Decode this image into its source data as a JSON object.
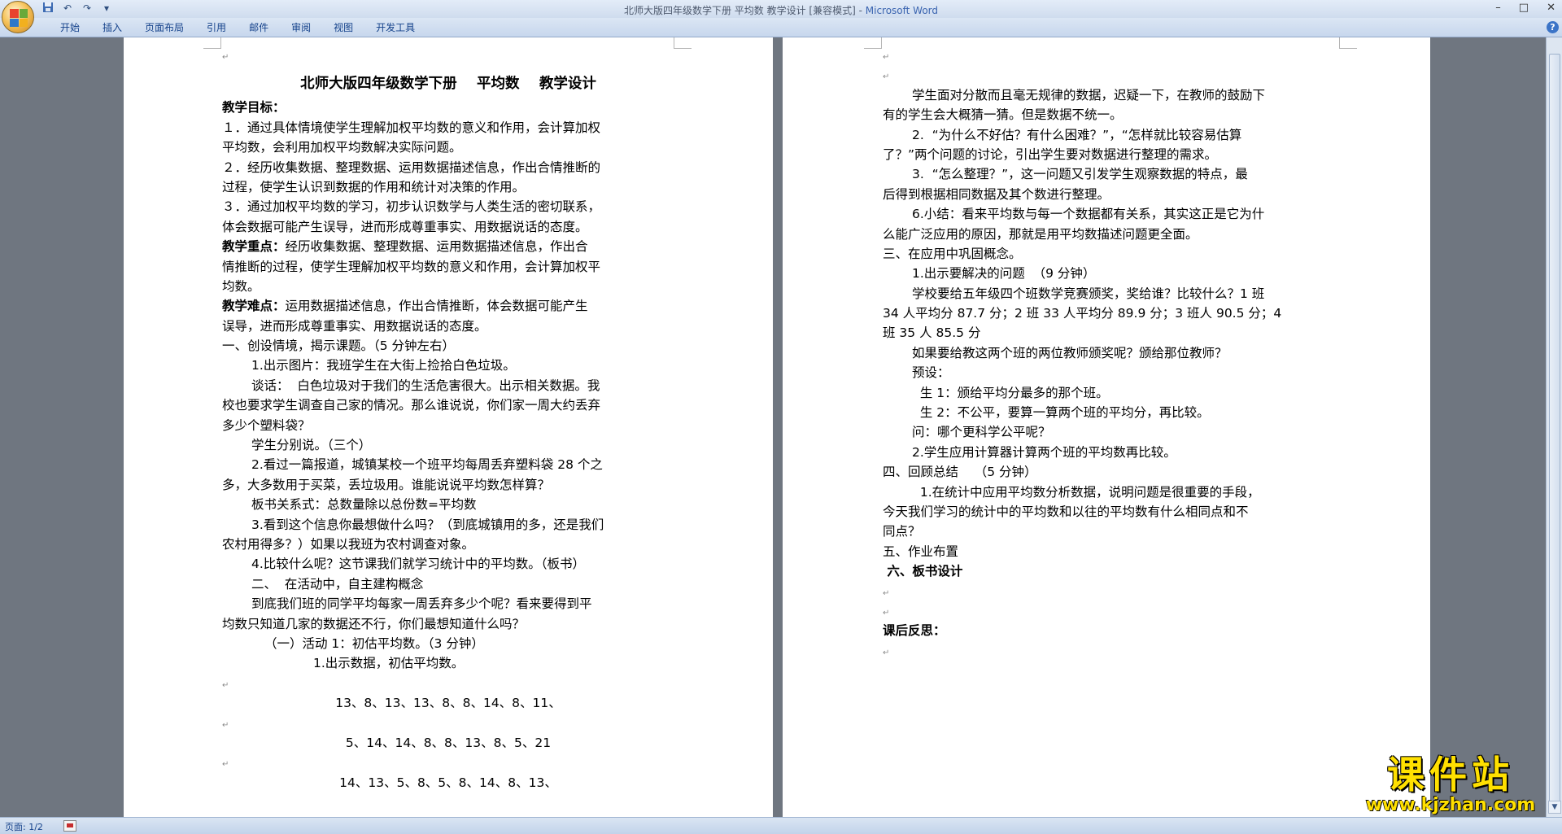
{
  "window": {
    "title": "北师大版四年级数学下册  平均数  教学设计 [兼容模式] - ",
    "app_name": "Microsoft Word",
    "minimize": "–",
    "maximize": "□",
    "close": "✕"
  },
  "qat": {
    "save_icon": "save-icon",
    "undo": "↶",
    "redo": "↷",
    "dropdown": "▾"
  },
  "ribbon": {
    "tabs": [
      "开始",
      "插入",
      "页面布局",
      "引用",
      "邮件",
      "审阅",
      "视图",
      "开发工具"
    ],
    "help": "?"
  },
  "page1": {
    "lines": [
      {
        "t": "",
        "s": "mark"
      },
      {
        "t": "北师大版四年级数学下册    平均数    教学设计",
        "s": "title"
      },
      {
        "t": "教学目标：",
        "s": "b"
      },
      {
        "t": "１．通过具体情境使学生理解加权平均数的意义和作用，会计算加权",
        "s": ""
      },
      {
        "t": "平均数，会利用加权平均数解决实际问题。",
        "s": ""
      },
      {
        "t": "２．经历收集数据、整理数据、运用数据描述信息，作出合情推断的",
        "s": ""
      },
      {
        "t": "过程，使学生认识到数据的作用和统计对决策的作用。",
        "s": ""
      },
      {
        "t": "３．通过加权平均数的学习，初步认识数学与人类生活的密切联系，",
        "s": ""
      },
      {
        "t": "体会数据可能产生误导，进而形成尊重事实、用数据说话的态度。",
        "s": ""
      },
      {
        "t": "教学重点：经历收集数据、整理数据、运用数据描述信息，作出合",
        "s": "bh"
      },
      {
        "t": "情推断的过程，使学生理解加权平均数的意义和作用，会计算加权平",
        "s": ""
      },
      {
        "t": "均数。",
        "s": ""
      },
      {
        "t": "教学难点：运用数据描述信息，作出合情推断，体会数据可能产生",
        "s": "bh"
      },
      {
        "t": "误导，进而形成尊重事实、用数据说话的态度。",
        "s": ""
      },
      {
        "t": "一、创设情境，揭示课题。（5 分钟左右）",
        "s": ""
      },
      {
        "t": "1.出示图片：我班学生在大街上捡拾白色垃圾。",
        "s": "i1"
      },
      {
        "t": "谈话：  白色垃圾对于我们的生活危害很大。出示相关数据。我",
        "s": "i1"
      },
      {
        "t": "校也要求学生调查自己家的情况。那么谁说说，你们家一周大约丢弃",
        "s": ""
      },
      {
        "t": "多少个塑料袋？",
        "s": ""
      },
      {
        "t": "学生分别说。（三个）",
        "s": "i1"
      },
      {
        "t": "2.看过一篇报道，城镇某校一个班平均每周丢弃塑料袋 28 个之",
        "s": "i1"
      },
      {
        "t": "多，大多数用于买菜，丢垃圾用。谁能说说平均数怎样算？",
        "s": ""
      },
      {
        "t": "板书关系式：总数量除以总份数=平均数",
        "s": "i1"
      },
      {
        "t": "3.看到这个信息你最想做什么吗？（到底城镇用的多，还是我们",
        "s": "i1"
      },
      {
        "t": "农村用得多？）如果以我班为农村调查对象。",
        "s": ""
      },
      {
        "t": "4.比较什么呢？这节课我们就学习统计中的平均数。（板书）",
        "s": "i1"
      },
      {
        "t": "二、  在活动中，自主建构概念",
        "s": "i1"
      },
      {
        "t": "到底我们班的同学平均每家一周丢弃多少个呢？看来要得到平",
        "s": "i1"
      },
      {
        "t": "均数只知道几家的数据还不行，你们最想知道什么吗？",
        "s": ""
      },
      {
        "t": "（一）活动 1：初估平均数。（3 分钟）",
        "s": "i2"
      },
      {
        "t": "1.出示数据，初估平均数。",
        "s": "i3"
      },
      {
        "t": "",
        "s": "mark"
      },
      {
        "t": "13、8、13、13、8、8、14、8、11、",
        "s": "c"
      },
      {
        "t": "",
        "s": "mark"
      },
      {
        "t": "5、14、14、8、8、13、8、5、21",
        "s": "c"
      },
      {
        "t": "",
        "s": "mark"
      },
      {
        "t": "14、13、5、8、5、8、14、8、13、",
        "s": "c"
      }
    ]
  },
  "page2": {
    "lines": [
      {
        "t": "",
        "s": "mark"
      },
      {
        "t": "",
        "s": "mark"
      },
      {
        "t": "学生面对分散而且毫无规律的数据，迟疑一下，在教师的鼓励下",
        "s": "i1"
      },
      {
        "t": "有的学生会大概猜一猜。但是数据不统一。",
        "s": ""
      },
      {
        "t": "2.  “为什么不好估？有什么困难？”，“怎样就比较容易估算",
        "s": "i1"
      },
      {
        "t": "了？”两个问题的讨论，引出学生要对数据进行整理的需求。",
        "s": ""
      },
      {
        "t": "3.  “怎么整理？”，这一问题又引发学生观察数据的特点，最",
        "s": "i1"
      },
      {
        "t": "后得到根据相同数据及其个数进行整理。",
        "s": ""
      },
      {
        "t": "6.小结：看来平均数与每一个数据都有关系，其实这正是它为什",
        "s": "i1"
      },
      {
        "t": "么能广泛应用的原因，那就是用平均数描述问题更全面。",
        "s": ""
      },
      {
        "t": "三、在应用中巩固概念。",
        "s": ""
      },
      {
        "t": "1.出示要解决的问题  （9 分钟）",
        "s": "i1"
      },
      {
        "t": "学校要给五年级四个班数学竞赛颁奖，奖给谁？比较什么？1 班",
        "s": "i1"
      },
      {
        "t": "34 人平均分 87.7 分；2 班 33 人平均分 89.9 分；3 班人 90.5 分；4",
        "s": ""
      },
      {
        "t": "班 35 人 85.5 分",
        "s": ""
      },
      {
        "t": "如果要给教这两个班的两位教师颁奖呢？颁给那位教师？",
        "s": "i1"
      },
      {
        "t": "预设：",
        "s": "i1"
      },
      {
        "t": "  生 1：颁给平均分最多的那个班。",
        "s": "i1"
      },
      {
        "t": "  生 2：不公平，要算一算两个班的平均分，再比较。",
        "s": "i1"
      },
      {
        "t": "问：哪个更科学公平呢？",
        "s": "i1"
      },
      {
        "t": "2.学生应用计算器计算两个班的平均数再比较。",
        "s": "i1"
      },
      {
        "t": "四、回顾总结    （5 分钟）",
        "s": ""
      },
      {
        "t": "  1.在统计中应用平均数分析数据，说明问题是很重要的手段，",
        "s": "i1"
      },
      {
        "t": "今天我们学习的统计中的平均数和以往的平均数有什么相同点和不",
        "s": ""
      },
      {
        "t": "同点？",
        "s": ""
      },
      {
        "t": "五、作业布置",
        "s": ""
      },
      {
        "t": " 六、板书设计",
        "s": "b"
      },
      {
        "t": "",
        "s": "mark"
      },
      {
        "t": "",
        "s": "mark"
      },
      {
        "t": "课后反思：",
        "s": "b"
      },
      {
        "t": "",
        "s": "mark"
      }
    ]
  },
  "status": {
    "page": "页面: 1/2"
  },
  "watermark": {
    "big": "课件站",
    "small": "www.kjzhan.com"
  }
}
